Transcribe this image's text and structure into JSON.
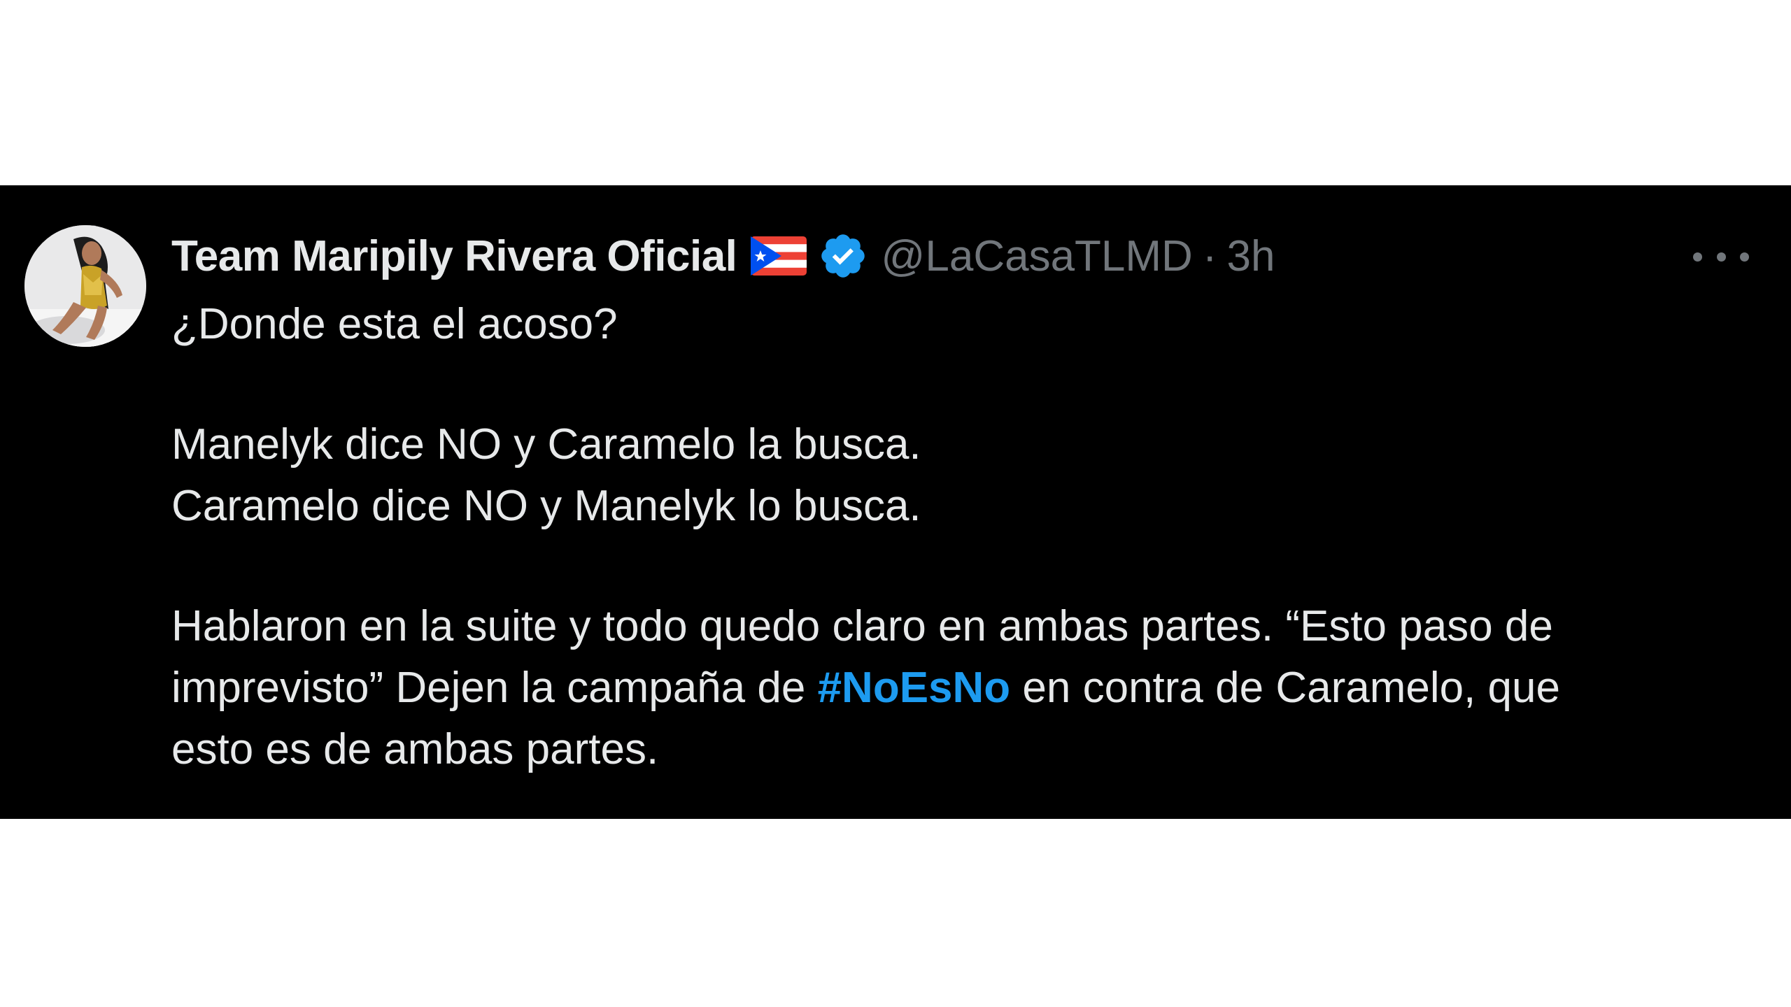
{
  "tweet": {
    "display_name": "Team Maripily Rivera Oficial",
    "flag_icon": "puerto-rico-flag-icon",
    "verified_icon": "verified-badge-icon",
    "handle": "@LaCasaTLMD",
    "separator": "·",
    "timestamp": "3h",
    "more_icon": "more-options-icon",
    "text": {
      "line1": "¿Donde esta el acoso?",
      "line2": "Manelyk dice NO y Caramelo la busca.",
      "line3": "Caramelo dice NO y Manelyk lo busca.",
      "para3_line1": "Hablaron en la suite y todo quedo claro en ambas partes. “Esto paso de",
      "para3_line2_before": "imprevisto” Dejen la campaña de ",
      "hashtag": "#NoEsNo",
      "para3_line2_after": " en contra de Caramelo, que",
      "para3_line3": "esto es de ambas partes."
    }
  },
  "colors": {
    "background": "#000000",
    "text_primary": "#e7e9ea",
    "text_secondary": "#71767b",
    "accent": "#1d9bf0"
  }
}
